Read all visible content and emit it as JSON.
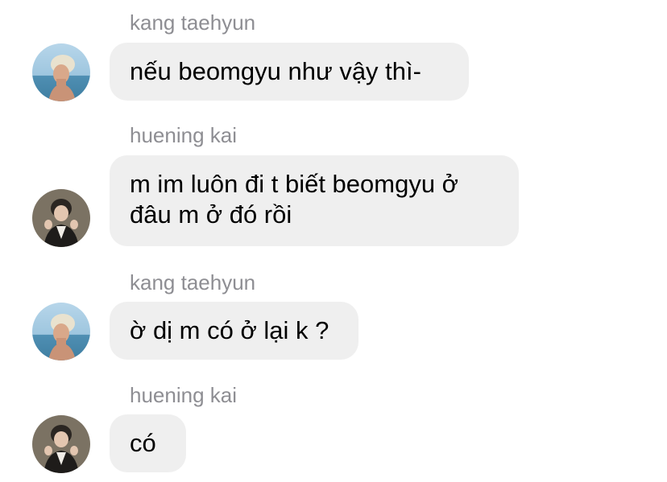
{
  "messages": [
    {
      "sender": "kang taehyun",
      "avatar_icon": "profile-photo-taehyun",
      "text": "nếu beomgyu như vậy thì-"
    },
    {
      "sender": "huening kai",
      "avatar_icon": "profile-photo-kai",
      "lines": [
        "m im luôn đi t biết beomgyu ở",
        "đâu m ở đó rồi"
      ]
    },
    {
      "sender": "kang taehyun",
      "avatar_icon": "profile-photo-taehyun",
      "text": "ờ dị m có ở lại k ?"
    },
    {
      "sender": "huening kai",
      "avatar_icon": "profile-photo-kai",
      "text": "có"
    }
  ],
  "colors": {
    "bubble": "#efefef",
    "sender_name": "#8e8e93",
    "text": "#000000"
  }
}
